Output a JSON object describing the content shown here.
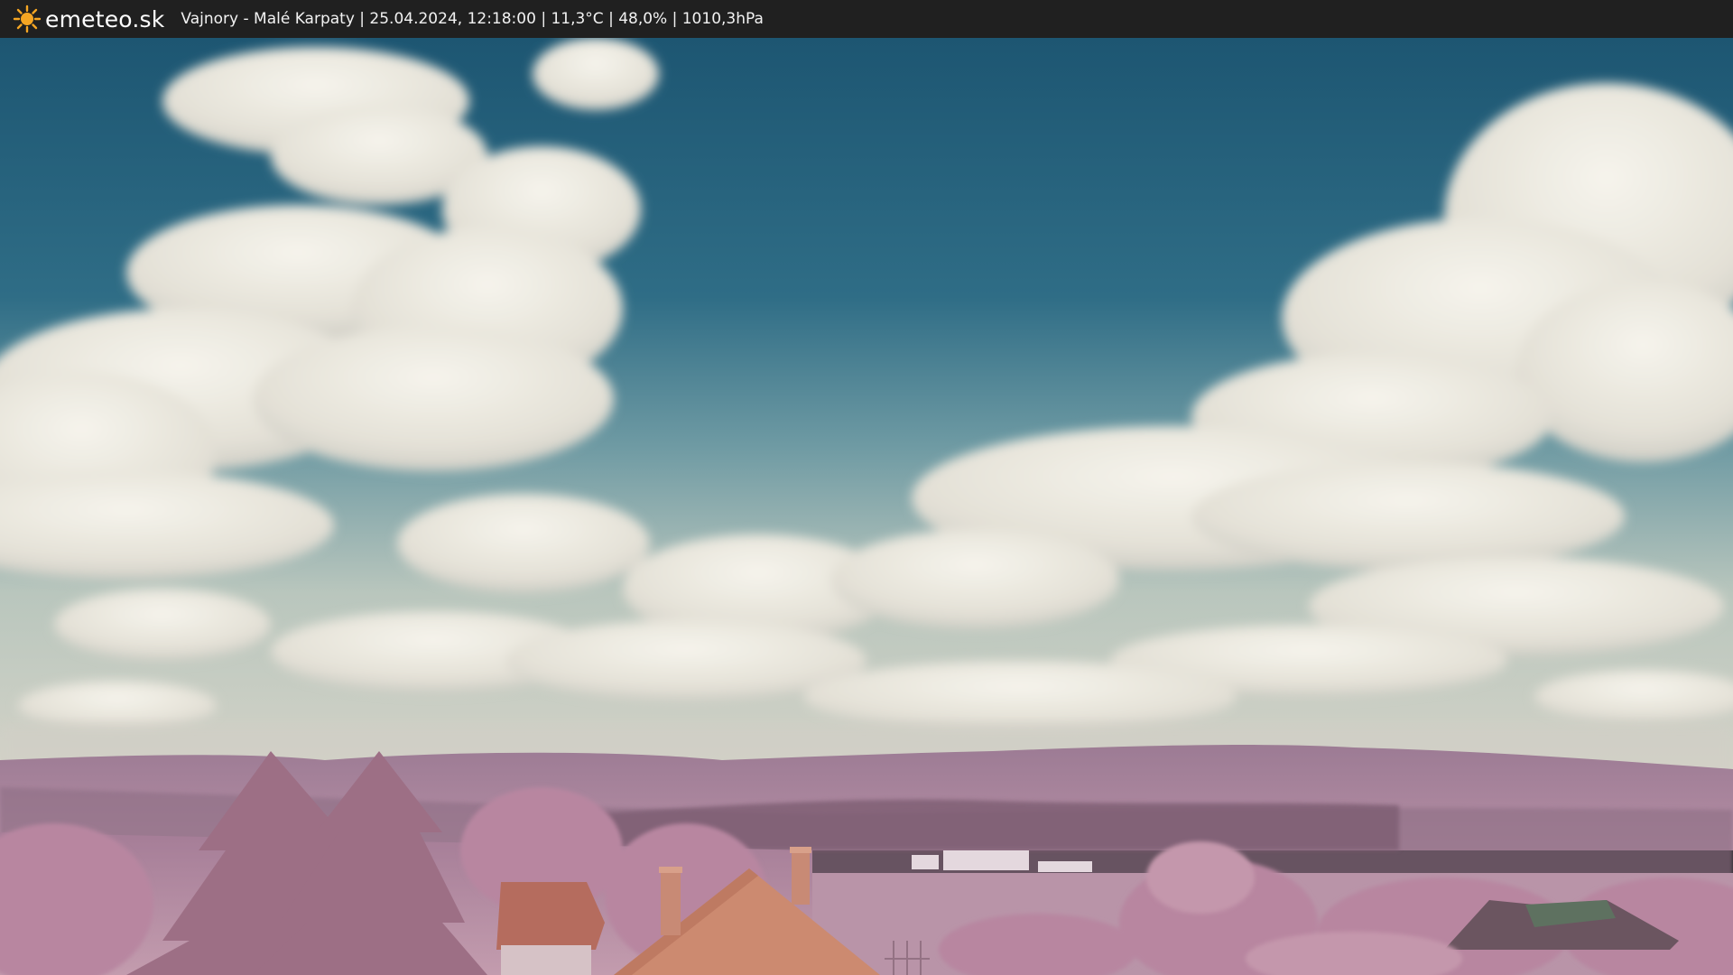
{
  "header": {
    "logo_text": "emeteo.sk",
    "logo_icon": "sun-icon",
    "station_info": "Vajnory - Malé Karpaty | 25.04.2024, 12:18:00 | 11,3°C | 48,0% | 1010,3hPa"
  },
  "colors": {
    "topbar": "#202020",
    "sun": "#f5a623",
    "sky_top": "#1d5672",
    "sky_horizon": "#c9cfc8",
    "cloud": "#efece4",
    "hills": "#a87f98",
    "trees": "#b17e93"
  }
}
